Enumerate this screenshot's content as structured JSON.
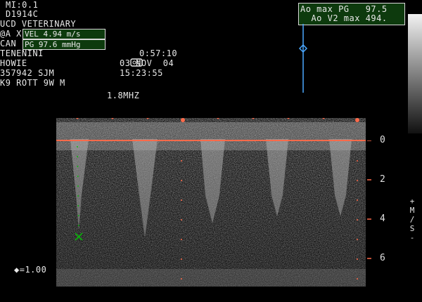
{
  "header": {
    "mi": "MI:0.1",
    "probe_id": "D1914C",
    "clinic": "UCD VETERINARY",
    "clinic_line2_prefix": "@A X",
    "clinic_line3_prefix": "CAN",
    "vel_label": "VEL 4.94 m/s",
    "pg_label": "PG 97.6 mmHg",
    "owner": "TENENINI",
    "patient": "HOWIE",
    "id": "357942 SJM",
    "species": "K9 ROTT 9W M",
    "timer": "0:57:10",
    "date": "03 NOV  04",
    "time": "15:23:55",
    "frequency": "1.8MHZ"
  },
  "measure_box": {
    "line1": "Ao max PG   97.5",
    "line2": "  Ao V2 max 494."
  },
  "scale": {
    "ticks": [
      "0",
      "2",
      "4",
      "6"
    ],
    "unit_chars": [
      "+",
      "M",
      "/",
      "S",
      "-"
    ]
  },
  "footer": {
    "zoom": "◆=1.00"
  },
  "colors": {
    "baseline": "#ff6a4a",
    "marker": "#00c000",
    "cursor": "#4aa8ff",
    "box_bg": "#0d3a0d"
  }
}
